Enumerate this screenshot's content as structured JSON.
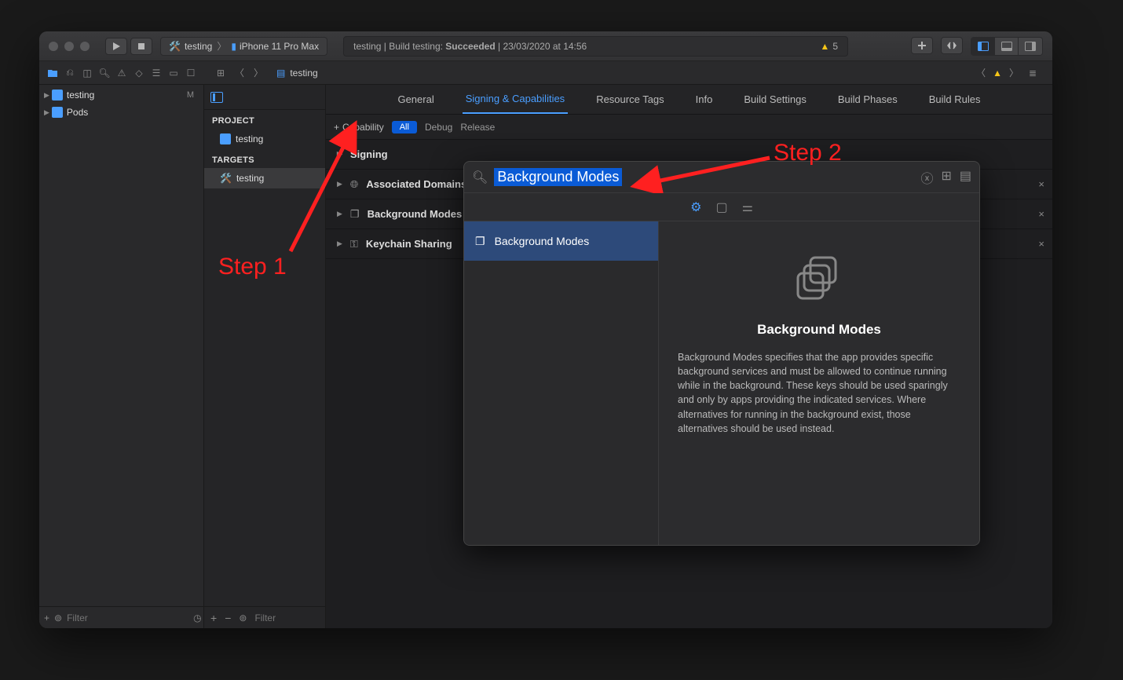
{
  "toolbar": {
    "scheme_target": "testing",
    "scheme_device": "iPhone 11 Pro Max",
    "status_prefix": "testing | Build testing: ",
    "status_result": "Succeeded",
    "status_suffix": " | 23/03/2020 at 14:56",
    "warning_count": "5"
  },
  "jumpbar": {
    "file": "testing"
  },
  "navigator": {
    "items": [
      {
        "name": "testing",
        "badge": "M"
      },
      {
        "name": "Pods",
        "badge": ""
      }
    ],
    "filter_placeholder": "Filter"
  },
  "targets_panel": {
    "project_header": "PROJECT",
    "project": "testing",
    "targets_header": "TARGETS",
    "target": "testing",
    "filter_placeholder": "Filter"
  },
  "editor_tabs": [
    "General",
    "Signing & Capabilities",
    "Resource Tags",
    "Info",
    "Build Settings",
    "Build Phases",
    "Build Rules"
  ],
  "active_tab_index": 1,
  "cap_bar": {
    "add_label": "Capability",
    "all": "All",
    "debug": "Debug",
    "release": "Release"
  },
  "capabilities": [
    {
      "label": "Signing",
      "icon": "",
      "head": true,
      "closable": false
    },
    {
      "label": "Associated Domains",
      "icon": "globe",
      "closable": true
    },
    {
      "label": "Background Modes",
      "icon": "stack",
      "closable": true
    },
    {
      "label": "Keychain Sharing",
      "icon": "key",
      "closable": true
    }
  ],
  "popover": {
    "search_value": "Background Modes",
    "list": [
      "Background Modes"
    ],
    "detail_title": "Background Modes",
    "detail_body": "Background Modes specifies that the app provides specific background services and must be allowed to continue running while in the background. These keys should be used sparingly and only by apps providing the indicated services. Where alternatives for running in the background exist, those alternatives should be used instead."
  },
  "annotations": {
    "step1": "Step 1",
    "step2": "Step 2"
  }
}
